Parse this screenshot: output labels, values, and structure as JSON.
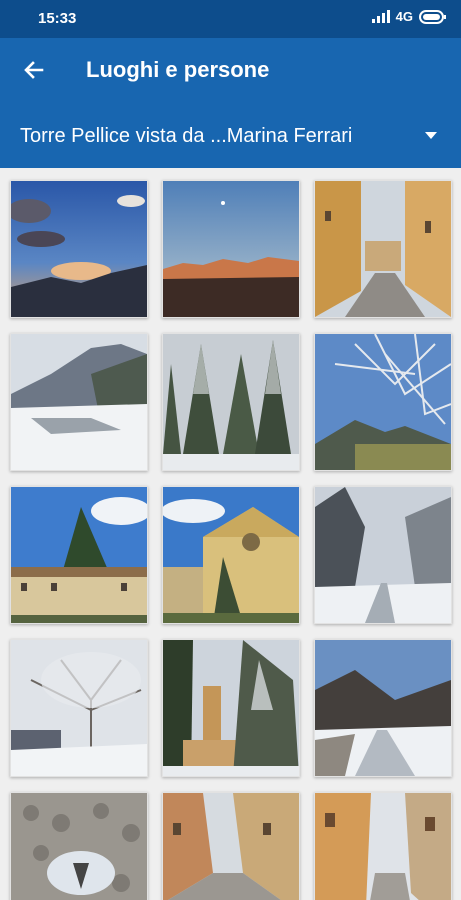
{
  "status": {
    "time": "15:33",
    "network": "4G"
  },
  "appbar": {
    "title": "Luoghi e persone"
  },
  "selector": {
    "label": "Torre Pellice vista da ...Marina Ferrari"
  },
  "photos": [
    {
      "name": "photo-sunset-clouds-mountains"
    },
    {
      "name": "photo-alpenglow-mountains"
    },
    {
      "name": "photo-street-yellow-buildings"
    },
    {
      "name": "photo-snowy-mountain-valley"
    },
    {
      "name": "photo-snowy-pine-trees"
    },
    {
      "name": "photo-snowy-tree-mountain"
    },
    {
      "name": "photo-villa-pine-tree"
    },
    {
      "name": "photo-yellow-church-facade"
    },
    {
      "name": "photo-snowy-road-trees"
    },
    {
      "name": "photo-snowy-tree-garden"
    },
    {
      "name": "photo-bell-tower-snow"
    },
    {
      "name": "photo-snowy-path-hills"
    },
    {
      "name": "photo-cobblestone-puddle"
    },
    {
      "name": "photo-cobblestone-street"
    },
    {
      "name": "photo-narrow-street-houses"
    }
  ]
}
